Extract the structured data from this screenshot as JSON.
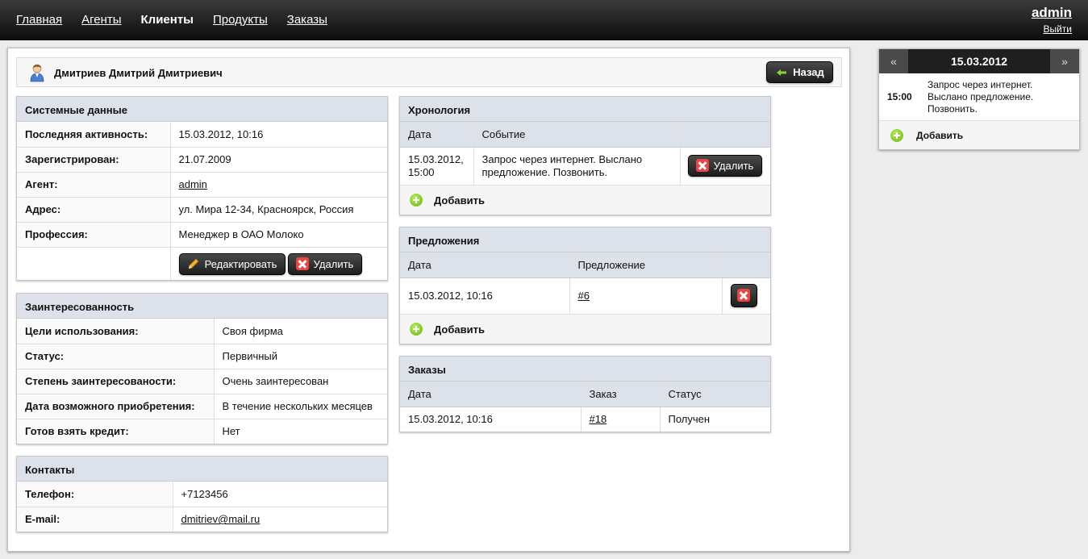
{
  "nav": {
    "items": [
      "Главная",
      "Агенты",
      "Клиенты",
      "Продукты",
      "Заказы"
    ],
    "active": "Клиенты",
    "user": "admin",
    "logout": "Выйти"
  },
  "client": {
    "name": "Дмитриев Дмитрий Дмитриевич",
    "back_label": "Назад"
  },
  "system": {
    "title": "Системные данные",
    "rows": [
      {
        "label": "Последняя активность:",
        "value": "15.03.2012, 10:16"
      },
      {
        "label": "Зарегистрирован:",
        "value": "21.07.2009"
      },
      {
        "label": "Агент:",
        "value": "admin"
      },
      {
        "label": "Адрес:",
        "value": "ул. Мира 12-34, Красноярск, Россия"
      },
      {
        "label": "Профессия:",
        "value": "Менеджер в ОАО Молоко"
      }
    ],
    "edit_label": "Редактировать",
    "delete_label": "Удалить"
  },
  "interest": {
    "title": "Заинтересованность",
    "rows": [
      {
        "label": "Цели использования:",
        "value": "Своя фирма"
      },
      {
        "label": "Статус:",
        "value": "Первичный"
      },
      {
        "label": "Степень заинтересованости:",
        "value": "Очень заинтересован"
      },
      {
        "label": "Дата возможного приобретения:",
        "value": "В течение нескольких месяцев"
      },
      {
        "label": "Готов взять кредит:",
        "value": "Нет"
      }
    ]
  },
  "contacts": {
    "title": "Контакты",
    "rows": [
      {
        "label": "Телефон:",
        "value": "+7123456"
      },
      {
        "label": "E-mail:",
        "value": "dmitriev@mail.ru"
      }
    ]
  },
  "chronology": {
    "title": "Хронология",
    "headers": [
      "Дата",
      "Событие"
    ],
    "rows": [
      {
        "date": "15.03.2012, 15:00",
        "event": "Запрос через интернет. Выслано предложение. Позвонить."
      }
    ],
    "delete_label": "Удалить",
    "add_label": "Добавить"
  },
  "offers": {
    "title": "Предложения",
    "headers": [
      "Дата",
      "Предложение"
    ],
    "rows": [
      {
        "date": "15.03.2012, 10:16",
        "offer": "#6"
      }
    ],
    "add_label": "Добавить"
  },
  "orders": {
    "title": "Заказы",
    "headers": [
      "Дата",
      "Заказ",
      "Статус"
    ],
    "rows": [
      {
        "date": "15.03.2012, 10:16",
        "order": "#18",
        "status": "Получен"
      }
    ]
  },
  "calendar": {
    "prev": "«",
    "next": "»",
    "date": "15.03.2012",
    "event_time": "15:00",
    "event_text": "Запрос через интернет. Выслано предложение. Позвонить.",
    "add_label": "Добавить"
  }
}
